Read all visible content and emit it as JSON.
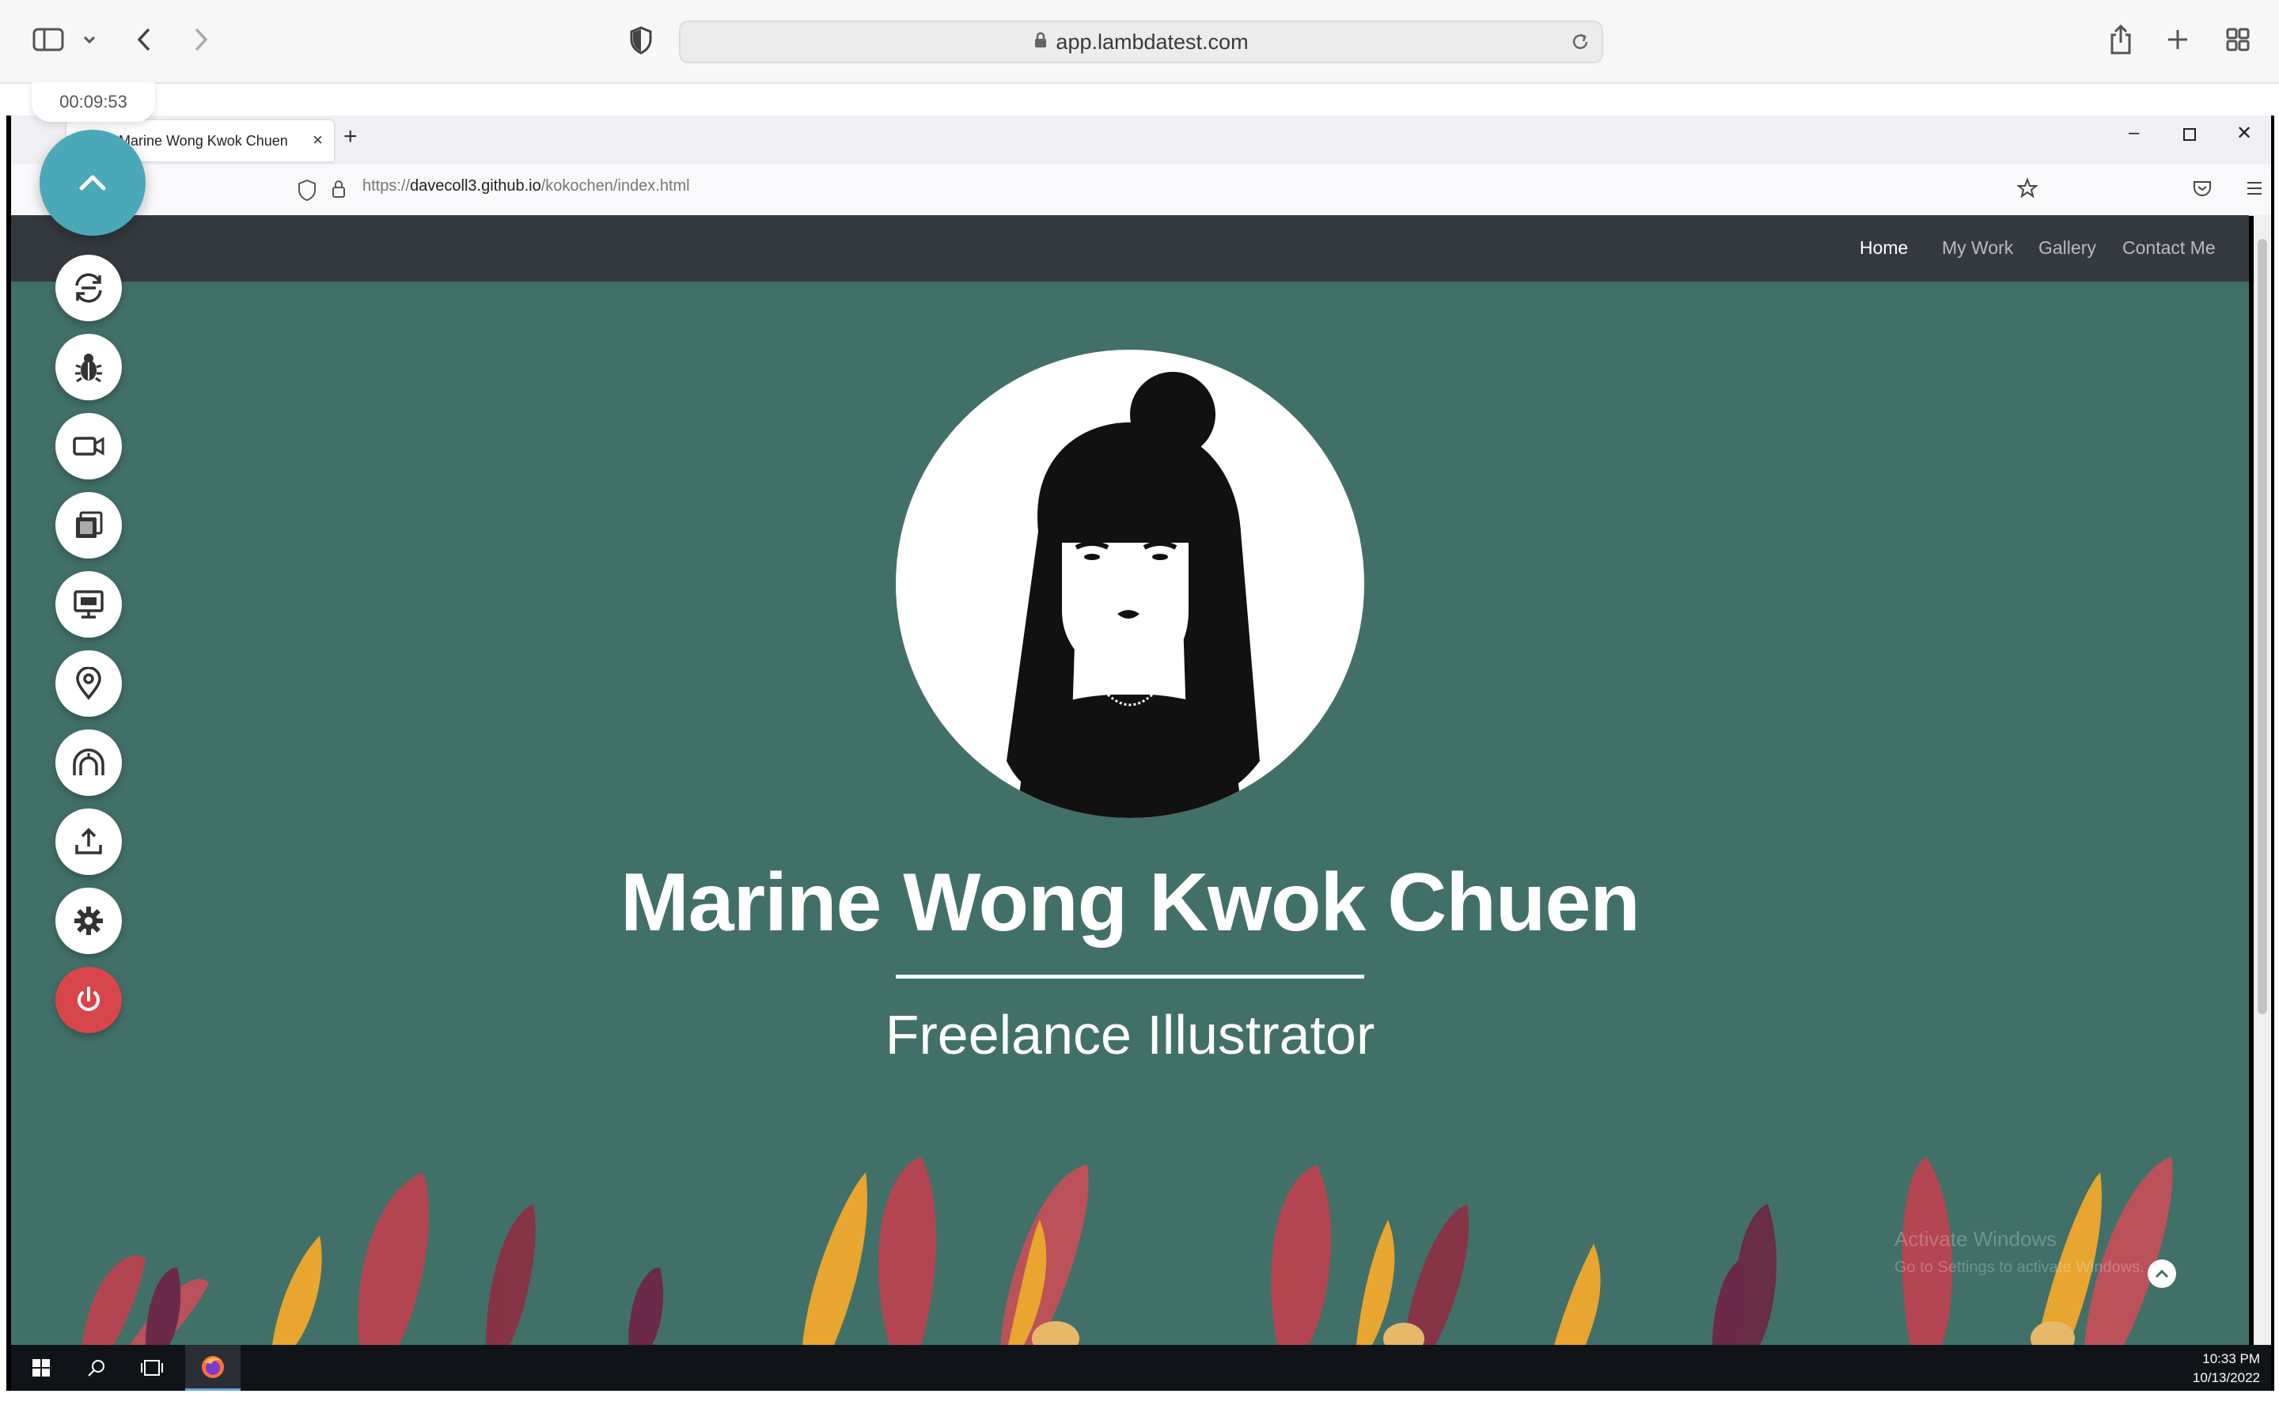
{
  "safari": {
    "address": "app.lambdatest.com"
  },
  "session": {
    "timer": "00:09:53"
  },
  "lambdatest_toolbar": {
    "items": [
      {
        "name": "collapse-toggle",
        "icon": "chevron-up-icon"
      },
      {
        "name": "switch-session",
        "icon": "refresh-arrows-icon"
      },
      {
        "name": "bug-report",
        "icon": "bug-icon"
      },
      {
        "name": "record-video",
        "icon": "video-camera-icon"
      },
      {
        "name": "screenshots",
        "icon": "gallery-icon"
      },
      {
        "name": "resolution",
        "icon": "monitor-icon"
      },
      {
        "name": "geolocation",
        "icon": "location-pin-icon"
      },
      {
        "name": "tunnel",
        "icon": "tunnel-icon"
      },
      {
        "name": "upload",
        "icon": "upload-icon"
      },
      {
        "name": "settings",
        "icon": "gear-icon"
      },
      {
        "name": "end-session",
        "icon": "power-icon",
        "color": "#d8454b"
      }
    ]
  },
  "firefox": {
    "tab_title": "Marine Wong Kwok Chuen",
    "url_prefix": "https://",
    "url_host": "davecoll3.github.io",
    "url_path": "/kokochen/index.html"
  },
  "site": {
    "nav": [
      "Home",
      "My Work",
      "Gallery",
      "Contact Me"
    ],
    "active_nav": "Home",
    "name": "Marine Wong Kwok Chuen",
    "subtitle": "Freelance Illustrator",
    "background_color": "#417068",
    "nav_color": "#343a40"
  },
  "windows": {
    "watermark_title": "Activate Windows",
    "watermark_text": "Go to Settings to activate Windows.",
    "time": "10:33 PM",
    "date": "10/13/2022"
  }
}
